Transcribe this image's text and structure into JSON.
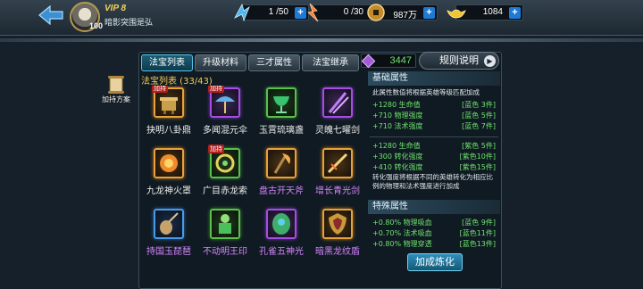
{
  "header": {
    "vip": "VIP 8",
    "player_name": "暗影突围是弘",
    "avatar_level": "100",
    "resources": {
      "vigor": "1 /50",
      "energy": "0 /30",
      "coins": "987万",
      "gold": "1084"
    },
    "energy_icon_label": "活"
  },
  "side": {
    "plan_label": "加持方案"
  },
  "tabs": [
    {
      "label": "法宝列表",
      "active": true
    },
    {
      "label": "升级材料",
      "active": false
    },
    {
      "label": "三才属性",
      "active": false
    },
    {
      "label": "法宝继承",
      "active": false
    }
  ],
  "gem_count": "3447",
  "rules_button": "规则说明",
  "list": {
    "header": "法宝列表 (33/43)",
    "items": [
      {
        "name": "抉明八卦鼎",
        "badge": "加持",
        "frame": "orange",
        "name_color": "white",
        "icon": "cauldron-icon"
      },
      {
        "name": "多闻混元伞",
        "badge": "加持",
        "frame": "purple",
        "name_color": "white",
        "icon": "umbrella-icon"
      },
      {
        "name": "玉霄琉璃盏",
        "badge": "",
        "frame": "green",
        "name_color": "white",
        "icon": "chalice-icon"
      },
      {
        "name": "灵魄七曜剑",
        "badge": "",
        "frame": "purple",
        "name_color": "white",
        "icon": "swords-icon"
      },
      {
        "name": "九龙神火罩",
        "badge": "",
        "frame": "orange",
        "name_color": "white",
        "icon": "fire-cover-icon"
      },
      {
        "name": "广目赤龙索",
        "badge": "加持",
        "frame": "green",
        "name_color": "white",
        "icon": "dragon-rope-icon"
      },
      {
        "name": "盘古开天斧",
        "badge": "",
        "frame": "orange",
        "name_color": "purple",
        "icon": "axe-icon"
      },
      {
        "name": "增长青光剑",
        "badge": "",
        "frame": "orange",
        "name_color": "purple",
        "icon": "green-sword-icon"
      },
      {
        "name": "持国玉琵琶",
        "badge": "",
        "frame": "blue",
        "name_color": "purple",
        "icon": "pipa-icon"
      },
      {
        "name": "不动明王印",
        "badge": "",
        "frame": "green",
        "name_color": "purple",
        "icon": "seal-icon"
      },
      {
        "name": "孔雀五神光",
        "badge": "",
        "frame": "purple",
        "name_color": "purple",
        "icon": "peacock-icon"
      },
      {
        "name": "暗黑龙纹盾",
        "badge": "",
        "frame": "orange",
        "name_color": "purple",
        "icon": "shield-icon"
      }
    ]
  },
  "attributes": {
    "basic_title": "基础属性",
    "basic_note": "此属性数值将根据英雄等级匹配加成",
    "basic_rows_1": [
      {
        "left": "+1280 生命值",
        "right": "[蓝色 3件]"
      },
      {
        "left": "+710 物理强度",
        "right": "[蓝色 5件]"
      },
      {
        "left": "+710 法术强度",
        "right": "[蓝色 7件]"
      }
    ],
    "basic_rows_2": [
      {
        "left": "+1280 生命值",
        "right": "[紫色 5件]"
      },
      {
        "left": "+300 转化强度",
        "right": "[紫色10件]"
      },
      {
        "left": "+410 转化强度",
        "right": "[紫色15件]"
      }
    ],
    "convert_note": "转化强度将根据不同的英雄转化为相应比例的物理和法术强度进行加成",
    "special_title": "特殊属性",
    "special_rows": [
      {
        "left": "+0.80% 物理吸血",
        "right": "[蓝色 9件]"
      },
      {
        "left": "+0.70% 法术吸血",
        "right": "[蓝色11件]"
      },
      {
        "left": "+0.80% 物理穿透",
        "right": "[蓝色13件]"
      }
    ]
  },
  "refine_button": "加成炼化",
  "colors": {
    "accent": "#55c5e6",
    "attr_green": "#6fe36f",
    "list_header": "#f6ce58",
    "legend_purple": "#d486ff"
  }
}
